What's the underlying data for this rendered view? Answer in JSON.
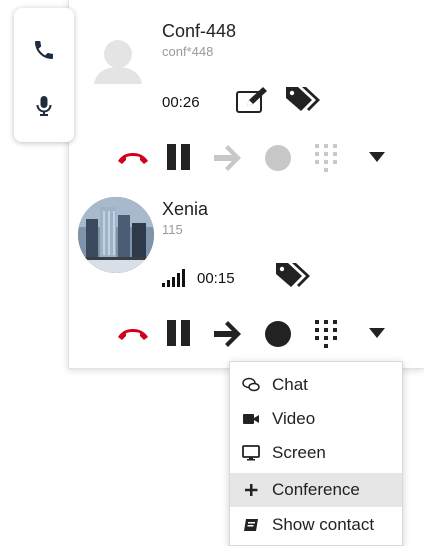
{
  "calls": [
    {
      "name": "Conf-448",
      "number": "conf*448",
      "duration": "00:26"
    },
    {
      "name": "Xenia",
      "number": "115",
      "duration": "00:15"
    }
  ],
  "menu": {
    "items": [
      {
        "label": "Chat",
        "icon": "chat-icon"
      },
      {
        "label": "Video",
        "icon": "video-camera-icon"
      },
      {
        "label": "Screen",
        "icon": "monitor-icon"
      },
      {
        "label": "Conference",
        "icon": "plus-icon"
      },
      {
        "label": "Show contact",
        "icon": "contact-card-icon"
      }
    ],
    "highlighted": "Conference"
  },
  "colors": {
    "hangup": "#d0021b",
    "control_active": "#222222",
    "control_disabled": "#c8c8c8",
    "menu_highlight": "#e6e6e6"
  }
}
